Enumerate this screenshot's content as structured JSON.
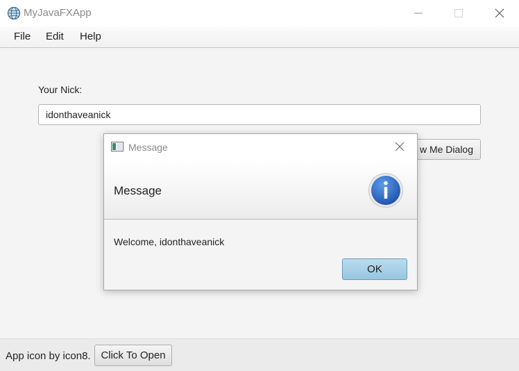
{
  "window": {
    "title": "MyJavaFXApp",
    "icon": "globe-icon"
  },
  "menu": {
    "items": [
      "File",
      "Edit",
      "Help"
    ]
  },
  "form": {
    "nick_label": "Your Nick:",
    "nick_value": "idonthaveanick",
    "show_dialog_label": "w Me Dialog"
  },
  "dialog": {
    "title": "Message",
    "header": "Message",
    "message": "Welcome, idonthaveanick",
    "ok_label": "OK",
    "icon": "info-icon"
  },
  "status": {
    "credit": "App icon by icon8.",
    "open_label": "Click To Open"
  },
  "colors": {
    "accent": "#2d6fc9",
    "ok_button": "#a8d1e8"
  }
}
